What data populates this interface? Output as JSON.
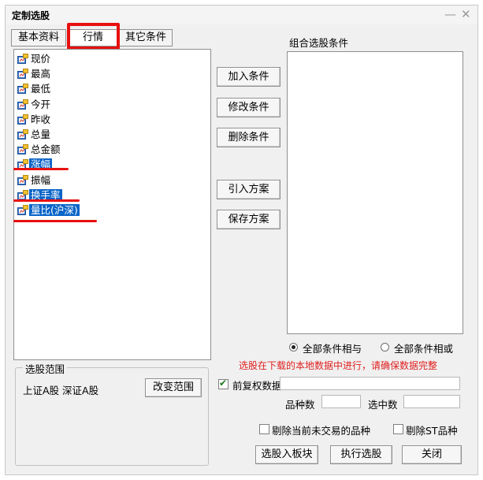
{
  "window": {
    "title": "定制选股"
  },
  "tabs": [
    {
      "label": "基本资料"
    },
    {
      "label": "行情"
    },
    {
      "label": "其它条件"
    }
  ],
  "indicators": [
    {
      "label": "现价",
      "selected": false
    },
    {
      "label": "最高",
      "selected": false
    },
    {
      "label": "最低",
      "selected": false
    },
    {
      "label": "今开",
      "selected": false
    },
    {
      "label": "昨收",
      "selected": false
    },
    {
      "label": "总量",
      "selected": false
    },
    {
      "label": "总金额",
      "selected": false
    },
    {
      "label": "涨幅",
      "selected": true
    },
    {
      "label": "振幅",
      "selected": false
    },
    {
      "label": "换手率",
      "selected": true
    },
    {
      "label": "量比(沪深)",
      "selected": true
    }
  ],
  "buttons": {
    "add": "加入条件",
    "modify": "修改条件",
    "delete": "删除条件",
    "import": "引入方案",
    "save": "保存方案",
    "change_range": "改变范围",
    "to_block": "选股入板块",
    "execute": "执行选股",
    "close": "关闭"
  },
  "combo": {
    "label": "组合选股条件"
  },
  "logic": {
    "and_label": "全部条件相与",
    "or_label": "全部条件相或",
    "selected": "and"
  },
  "notice": "选股在下载的本地数据中进行，请确保数据完整",
  "pre_adjust": {
    "label": "前复权数据",
    "checked": true
  },
  "counts": {
    "variety_label": "品种数",
    "selected_label": "选中数"
  },
  "exclude": {
    "suspended": "剔除当前未交易的品种",
    "st": "剔除ST品种"
  },
  "range": {
    "title": "选股范围",
    "value": "上证A股 深证A股"
  },
  "colors": {
    "highlight": "#e81010",
    "selection": "#0a64c8",
    "notice": "#e02020"
  }
}
